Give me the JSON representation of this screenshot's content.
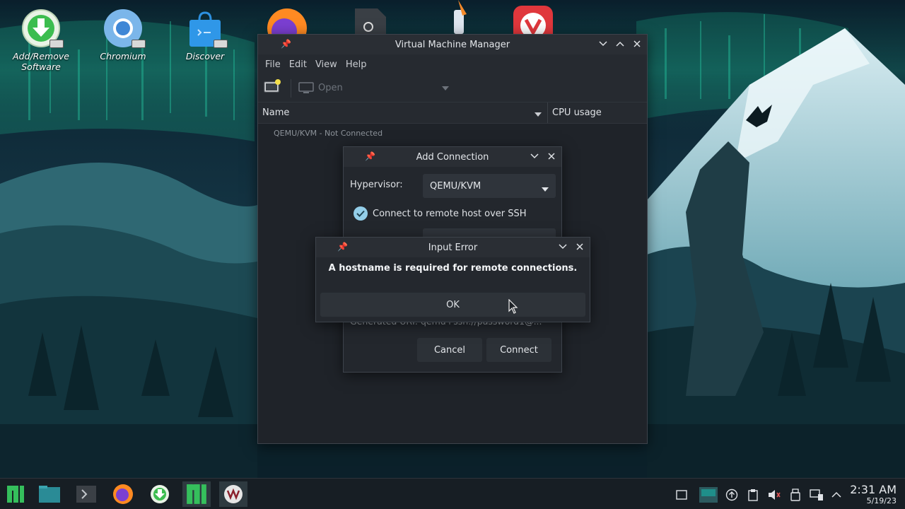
{
  "desktop": {
    "icons": [
      {
        "label_line1": "Add/Remove",
        "label_line2": "Software",
        "icon": "package-download-icon"
      },
      {
        "label": "Chromium",
        "icon": "chromium-icon"
      },
      {
        "label": "Discover",
        "icon": "store-bag-icon"
      }
    ]
  },
  "vmm": {
    "title": "Virtual Machine Manager",
    "menu": [
      "File",
      "Edit",
      "View",
      "Help"
    ],
    "toolbar": {
      "open_label": "Open"
    },
    "columns": {
      "name": "Name",
      "cpu": "CPU usage"
    },
    "connection_status": "QEMU/KVM - Not Connected"
  },
  "add_connection": {
    "title": "Add Connection",
    "hypervisor_label": "Hypervisor:",
    "hypervisor_value": "QEMU/KVM",
    "ssh_label": "Connect to remote host over SSH",
    "generated_uri": "Generated URI:  qemu+ssh://password1@...",
    "cancel_label": "Cancel",
    "connect_label": "Connect"
  },
  "input_error": {
    "title": "Input Error",
    "message": "A hostname is required for remote connections.",
    "ok_label": "OK"
  },
  "taskbar": {
    "time": "2:31 AM",
    "date": "5/19/23"
  },
  "colors": {
    "accent": "#35bf5c",
    "check": "#93cee9",
    "window_bg": "#22262c"
  }
}
